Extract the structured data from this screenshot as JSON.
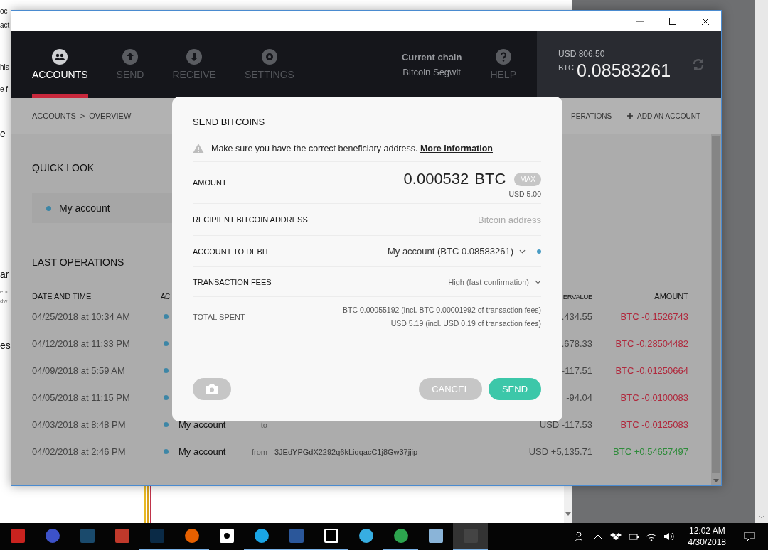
{
  "background_window": {
    "fragments": [
      "oc",
      "act",
      "his",
      "e f",
      "e",
      "ar",
      "enc",
      "dw",
      "es"
    ]
  },
  "app": {
    "nav": [
      {
        "label": "ACCOUNTS",
        "selected": true
      },
      {
        "label": "SEND",
        "selected": false
      },
      {
        "label": "RECEIVE",
        "selected": false
      },
      {
        "label": "SETTINGS",
        "selected": false
      }
    ],
    "current_chain": {
      "label": "Current chain",
      "value": "Bitcoin Segwit"
    },
    "help": "HELP",
    "balance": {
      "usd": "USD 806.50",
      "btc_label": "BTC",
      "btc": "0.08583261"
    },
    "breadcrumb": [
      "ACCOUNTS",
      ">",
      "OVERVIEW"
    ],
    "actions": [
      "PERATIONS",
      "ADD AN ACCOUNT"
    ],
    "quick_look": {
      "title": "QUICK LOOK",
      "accounts": [
        {
          "name": "My account",
          "color": "#3d86a6"
        }
      ]
    },
    "last_operations": {
      "title": "LAST OPERATIONS",
      "columns": [
        "DATE AND TIME",
        "AC",
        "ERVALUE",
        "AMOUNT"
      ],
      "rows": [
        {
          "date": "04/25/2018 at 10:34 AM",
          "countervalue": ".434.55",
          "amount": "BTC -0.1526743",
          "kind": "out"
        },
        {
          "date": "04/12/2018 at 11:33 PM",
          "countervalue": ".678.33",
          "amount": "BTC -0.28504482",
          "kind": "out"
        },
        {
          "date": "04/09/2018 at 5:59 AM",
          "countervalue": "-117.51",
          "amount": "BTC -0.01250664",
          "kind": "out"
        },
        {
          "date": "04/05/2018 at 11:15 PM",
          "countervalue": "-94.04",
          "amount": "BTC -0.0100083",
          "kind": "out"
        },
        {
          "date": "04/03/2018 at 8:48 PM",
          "account": "My account",
          "direction": "to",
          "countervalue": "USD -117.53",
          "amount": "BTC -0.0125083",
          "kind": "out"
        },
        {
          "date": "04/02/2018 at 2:46 PM",
          "account": "My account",
          "direction": "from",
          "address": "3JEdYPGdX2292q6kLiqqacC1j8Gw37jjip",
          "countervalue": "USD +5,135.71",
          "amount": "BTC +0.54657497",
          "kind": "in"
        }
      ]
    }
  },
  "modal": {
    "title": "SEND BITCOINS",
    "warning": "Make sure you have the correct beneficiary address.",
    "link": "More information",
    "amount": {
      "label": "AMOUNT",
      "value": "0.000532",
      "unit": "BTC",
      "max": "MAX",
      "usd": "USD 5.00"
    },
    "recipient": {
      "label": "RECIPIENT BITCOIN ADDRESS",
      "placeholder": "Bitcoin address"
    },
    "account": {
      "label": "ACCOUNT TO DEBIT",
      "value": "My account (BTC 0.08583261)",
      "color": "#4a9cc4"
    },
    "fees": {
      "label": "TRANSACTION FEES",
      "value": "High (fast confirmation)"
    },
    "total": {
      "label": "TOTAL SPENT",
      "lines": [
        "BTC 0.00055192 (incl. BTC 0.00001992 of transaction fees)",
        "USD 5.19 (incl. USD 0.19 of transaction fees)"
      ]
    },
    "cancel": "CANCEL",
    "send": "SEND"
  },
  "taskbar": {
    "time": "12:02 AM",
    "date": "4/30/2018"
  }
}
